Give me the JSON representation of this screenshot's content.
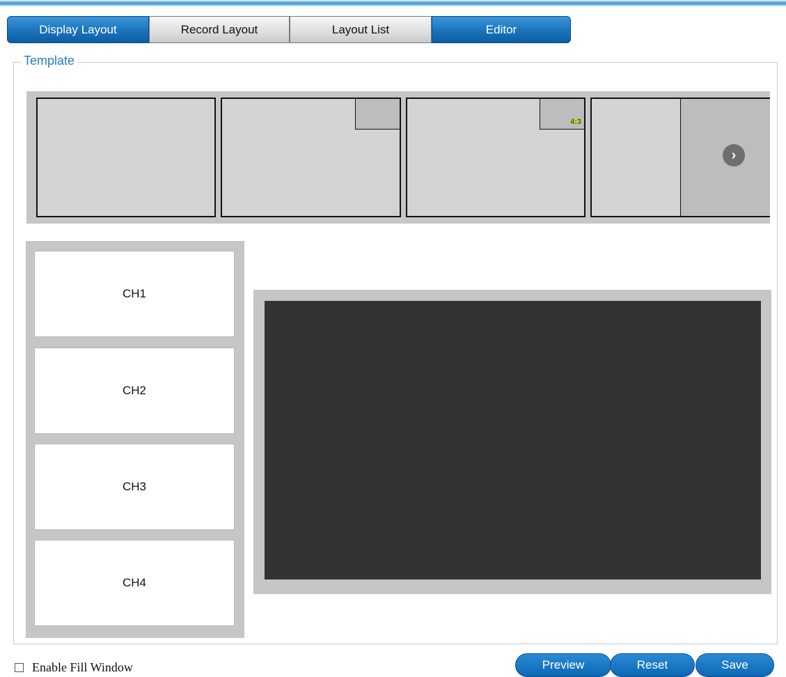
{
  "tabs": [
    {
      "label": "Display Layout",
      "active": true
    },
    {
      "label": "Record Layout",
      "active": false
    },
    {
      "label": "Layout List",
      "active": false
    },
    {
      "label": "Editor",
      "active": true
    }
  ],
  "template": {
    "legend": "Template",
    "thumb_ratio_label": "4:3",
    "next_icon": "chevron-right-icon"
  },
  "channels": [
    "CH1",
    "CH2",
    "CH3",
    "CH4"
  ],
  "footer": {
    "checkbox_label": "Enable Fill Window",
    "checkbox_checked": false,
    "buttons": {
      "preview": "Preview",
      "reset": "Reset",
      "save": "Save"
    }
  },
  "colors": {
    "accent": "#1a73bb",
    "legend_text": "#2a7cc7",
    "preview_screen": "#333333",
    "panel_gray": "#c6c6c6"
  }
}
